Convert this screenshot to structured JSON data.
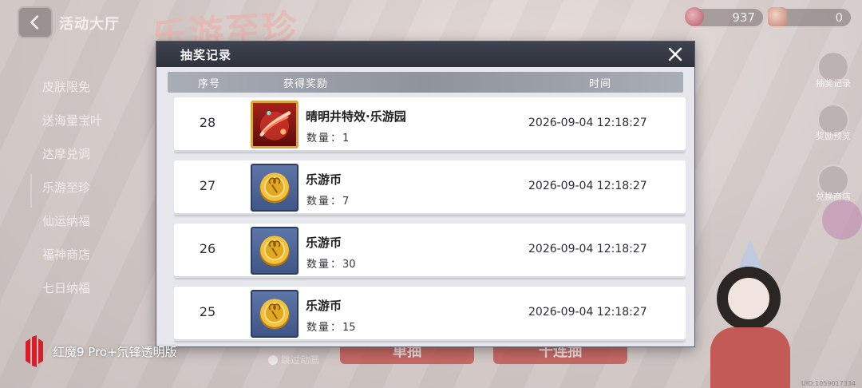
{
  "header": {
    "hall_title": "活动大厅",
    "big_title": "乐游至珍",
    "currency_1": "937",
    "currency_2": "0"
  },
  "sidebar": {
    "items": [
      {
        "label": "皮肤限免"
      },
      {
        "label": "送海量宝叶"
      },
      {
        "label": "达摩兑调"
      },
      {
        "label": "乐游至珍"
      },
      {
        "label": "仙运纳福"
      },
      {
        "label": "福神商店"
      },
      {
        "label": "七日纳福"
      }
    ]
  },
  "right_buttons": [
    {
      "label": "抽奖记录"
    },
    {
      "label": "奖励预览"
    },
    {
      "label": "兑换商店"
    }
  ],
  "bottom": {
    "single_draw": "单抽",
    "ten_draw": "十连抽",
    "skip_anim": "跳过动画"
  },
  "dialog": {
    "title": "抽奖记录",
    "columns": {
      "no": "序号",
      "prize": "获得奖励",
      "time": "时间"
    },
    "qty_label": "数量：",
    "records": [
      {
        "no": "28",
        "icon": "effect-icon",
        "name": "晴明井特效·乐游园",
        "qty": "1",
        "time": "2026-09-04 12:18:27"
      },
      {
        "no": "27",
        "icon": "coin-icon",
        "name": "乐游币",
        "qty": "7",
        "time": "2026-09-04 12:18:27"
      },
      {
        "no": "26",
        "icon": "coin-icon",
        "name": "乐游币",
        "qty": "30",
        "time": "2026-09-04 12:18:27"
      },
      {
        "no": "25",
        "icon": "coin-icon",
        "name": "乐游币",
        "qty": "15",
        "time": "2026-09-04 12:18:27"
      }
    ]
  },
  "watermark": "红魔9 Pro+氘锋透明版",
  "uid": "UID:1059017334",
  "colors": {
    "dialog_header": "#2e323c",
    "dialog_body": "#e5e7ec",
    "row_bg": "#ffffff",
    "coin_bg": "#3f5686",
    "effect_bg": "#a7221a",
    "effect_border": "#d7a73a"
  }
}
